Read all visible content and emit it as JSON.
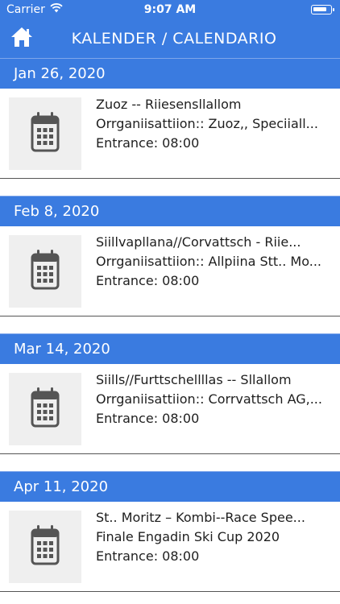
{
  "status_bar": {
    "carrier": "Carrier",
    "time": "9:07 AM"
  },
  "nav": {
    "title": "KALENDER / CALENDARIO",
    "home_icon": "home-icon"
  },
  "colors": {
    "accent": "#3a7be0",
    "thumb_bg": "#efefef",
    "icon": "#555555"
  },
  "events": [
    {
      "date": "Jan 26, 2020",
      "title": "Zuoz -- Riiesensllallom",
      "organisation": "Orrganiisattiion:: Zuoz,, Speciiall...",
      "entrance": "Entrance: 08:00",
      "icon": "calendar-icon"
    },
    {
      "date": "Feb 8, 2020",
      "title": "Siillvapllana//Corvattsch - Riie...",
      "organisation": "Orrganiisattiion:: Allpiina Stt.. Mo...",
      "entrance": "Entrance: 08:00",
      "icon": "calendar-icon"
    },
    {
      "date": "Mar 14, 2020",
      "title": "Siills//Furttschellllas -- Sllallom",
      "organisation": "Orrganiisattiion:: Corrvattsch AG,...",
      "entrance": "Entrance: 08:00",
      "icon": "calendar-icon"
    },
    {
      "date": "Apr 11, 2020",
      "title": "St.. Moritz – Kombi--Race Spee...",
      "organisation": "Finale Engadin Ski Cup 2020",
      "entrance": "Entrance: 08:00",
      "icon": "calendar-icon"
    }
  ]
}
